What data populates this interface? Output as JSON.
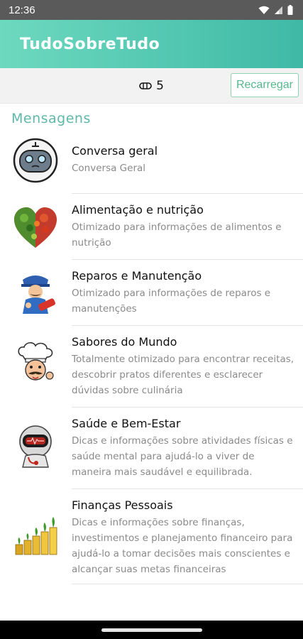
{
  "status_bar": {
    "time": "12:36",
    "icons": [
      "wifi-icon",
      "signal-icon",
      "battery-icon"
    ]
  },
  "app_bar": {
    "title": "TudoSobreTudo",
    "color": "#4cc6ae"
  },
  "toolbar": {
    "credits_icon": "coin-stack-icon",
    "credits_count": "5",
    "reload_label": "Recarregar"
  },
  "section": {
    "title": "Mensagens"
  },
  "chats": [
    {
      "title": "Conversa geral",
      "description": "Conversa Geral",
      "icon": "robot-avatar-icon"
    },
    {
      "title": "Alimentação e nutrição",
      "description": "Otimizado para informações de alimentos e nutrição",
      "icon": "vegetable-heart-icon"
    },
    {
      "title": "Reparos e Manutenção",
      "description": "Otimizado para informações de reparos e manutenções",
      "icon": "repairman-icon"
    },
    {
      "title": "Sabores do Mundo",
      "description": "Totalmente otimizado para encontrar receitas, descobrir pratos diferentes e esclarecer dúvidas sobre culinária",
      "icon": "chef-icon"
    },
    {
      "title": "Saúde e Bem-Estar",
      "description": "Dicas e informações sobre atividades físicas e saúde mental para ajudá-lo a viver de maneira mais saudável e equilibrada.",
      "icon": "health-robot-icon"
    },
    {
      "title": "Finanças Pessoais",
      "description": "Dicas e informações sobre finanças, investimentos e planejamento financeiro para ajudá-lo a tomar decisões mais conscientes e alcançar suas metas financeiras",
      "icon": "coins-growth-icon"
    }
  ]
}
